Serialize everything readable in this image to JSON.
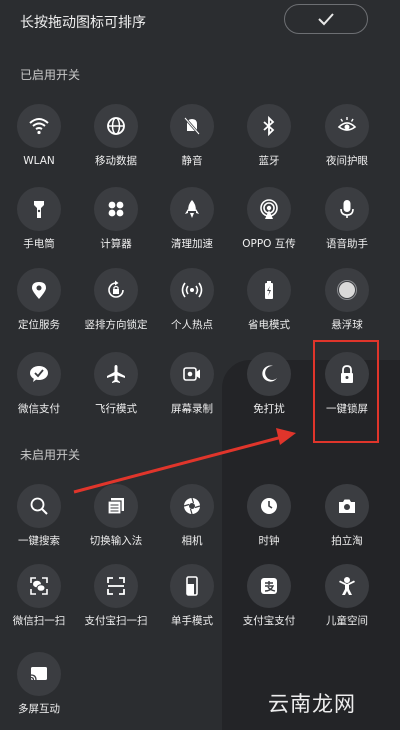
{
  "header": {
    "title": "长按拖动图标可排序",
    "confirm_icon": "check-icon"
  },
  "sections": {
    "enabled_title": "已启用开关",
    "disabled_title": "未启用开关"
  },
  "enabled": [
    {
      "label": "WLAN",
      "icon": "wifi-icon"
    },
    {
      "label": "移动数据",
      "icon": "globe-icon"
    },
    {
      "label": "静音",
      "icon": "mute-bell-icon"
    },
    {
      "label": "蓝牙",
      "icon": "bluetooth-icon"
    },
    {
      "label": "夜间护眼",
      "icon": "eye-icon"
    },
    {
      "label": "手电筒",
      "icon": "flashlight-icon"
    },
    {
      "label": "计算器",
      "icon": "calculator-icon"
    },
    {
      "label": "清理加速",
      "icon": "rocket-icon"
    },
    {
      "label": "OPPO 互传",
      "icon": "share-signal-icon"
    },
    {
      "label": "语音助手",
      "icon": "microphone-icon"
    },
    {
      "label": "定位服务",
      "icon": "location-pin-icon"
    },
    {
      "label": "竖排方向锁定",
      "icon": "rotation-lock-icon"
    },
    {
      "label": "个人热点",
      "icon": "hotspot-icon"
    },
    {
      "label": "省电模式",
      "icon": "battery-icon"
    },
    {
      "label": "悬浮球",
      "icon": "floating-ball-icon"
    },
    {
      "label": "微信支付",
      "icon": "wechat-pay-icon"
    },
    {
      "label": "飞行模式",
      "icon": "airplane-icon"
    },
    {
      "label": "屏幕录制",
      "icon": "screen-record-icon"
    },
    {
      "label": "免打扰",
      "icon": "moon-icon"
    },
    {
      "label": "一键锁屏",
      "icon": "lock-icon"
    }
  ],
  "disabled": [
    {
      "label": "一键搜索",
      "icon": "search-icon"
    },
    {
      "label": "切换输入法",
      "icon": "keyboard-icon"
    },
    {
      "label": "相机",
      "icon": "camera-aperture-icon"
    },
    {
      "label": "时钟",
      "icon": "clock-icon"
    },
    {
      "label": "拍立淘",
      "icon": "photo-search-icon"
    },
    {
      "label": "微信扫一扫",
      "icon": "wechat-scan-icon"
    },
    {
      "label": "支付宝扫一扫",
      "icon": "scan-icon"
    },
    {
      "label": "单手模式",
      "icon": "one-hand-icon"
    },
    {
      "label": "支付宝支付",
      "icon": "alipay-icon"
    },
    {
      "label": "儿童空间",
      "icon": "child-icon"
    },
    {
      "label": "多屏互动",
      "icon": "cast-icon"
    }
  ],
  "watermark": "云南龙网",
  "colors": {
    "background": "#2b2d30",
    "tile": "#3b3d41",
    "annotation": "#e0352b"
  }
}
